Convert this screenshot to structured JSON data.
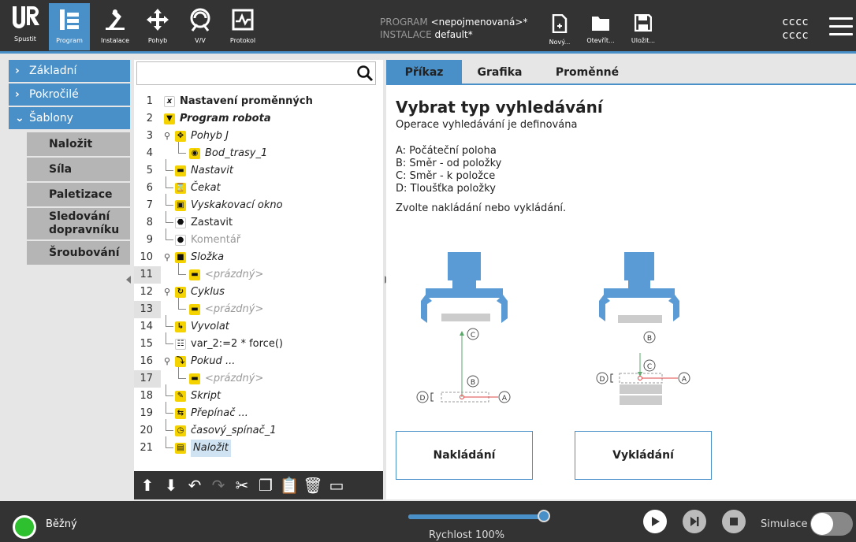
{
  "nav": {
    "logo_label": "Spustit",
    "buttons": [
      {
        "label": "Program",
        "icon": "program-icon"
      },
      {
        "label": "Instalace",
        "icon": "robot-arm-icon"
      },
      {
        "label": "Pohyb",
        "icon": "move-arrows-icon"
      },
      {
        "label": "V/V",
        "icon": "io-icon"
      },
      {
        "label": "Protokol",
        "icon": "log-icon"
      }
    ]
  },
  "program_info": {
    "program_key": "PROGRAM",
    "program_value": "<nepojmenovaná>*",
    "install_key": "INSTALACE",
    "install_value": "default*"
  },
  "file_buttons": {
    "new": "Nový...",
    "open": "Otevřít...",
    "save": "Uložit..."
  },
  "user": {
    "line1": "cccc",
    "line2": "cccc"
  },
  "sidebar": {
    "categories": [
      "Základní",
      "Pokročilé",
      "Šablony"
    ],
    "templates": [
      "Naložit",
      "Síla",
      "Paletizace",
      "Sledování dopravníku",
      "Šroubování"
    ]
  },
  "tree": {
    "search_placeholder": "",
    "rows": [
      {
        "num": "1",
        "label": "Nastavení proměnných"
      },
      {
        "num": "2",
        "label": "Program robota"
      },
      {
        "num": "3",
        "label": "Pohyb J"
      },
      {
        "num": "4",
        "label": "Bod_trasy_1"
      },
      {
        "num": "5",
        "label": "Nastavit"
      },
      {
        "num": "6",
        "label": "Čekat"
      },
      {
        "num": "7",
        "label": "Vyskakovací okno"
      },
      {
        "num": "8",
        "label": "Zastavit"
      },
      {
        "num": "9",
        "label": "Komentář"
      },
      {
        "num": "10",
        "label": "Složka"
      },
      {
        "num": "11",
        "label": "<prázdný>"
      },
      {
        "num": "12",
        "label": "Cyklus"
      },
      {
        "num": "13",
        "label": "<prázdný>"
      },
      {
        "num": "14",
        "label": "Vyvolat"
      },
      {
        "num": "15",
        "label": "var_2:=2 * force()"
      },
      {
        "num": "16",
        "label": "Pokud ..."
      },
      {
        "num": "17",
        "label": "<prázdný>"
      },
      {
        "num": "18",
        "label": "Skript"
      },
      {
        "num": "19",
        "label": "Přepínač ..."
      },
      {
        "num": "20",
        "label": "časový_spínač_1"
      },
      {
        "num": "21",
        "label": "Naložit"
      }
    ]
  },
  "tabs": [
    "Příkaz",
    "Grafika",
    "Proměnné"
  ],
  "main": {
    "title": "Vybrat typ vyhledávání",
    "subtitle": "Operace vyhledávání je definována",
    "legend": [
      "A: Počáteční poloha",
      "B: Směr - od položky",
      "C: Směr - k položce",
      "D: Tloušťka položky"
    ],
    "instruction": "Zvolte nakládání nebo vykládání.",
    "labels": {
      "a": "A",
      "b": "B",
      "c": "C",
      "d": "D"
    },
    "button_load": "Nakládání",
    "button_unload": "Vykládání"
  },
  "footer": {
    "status": "Běžný",
    "speed_label": "Rychlost 100%",
    "speed_fraction": 1.0,
    "simulation_label": "Simulace"
  },
  "colors": {
    "accent": "#4a90c8",
    "topbar": "#333333",
    "status_ok": "#2ec02e",
    "highlight": "#f5d300"
  }
}
